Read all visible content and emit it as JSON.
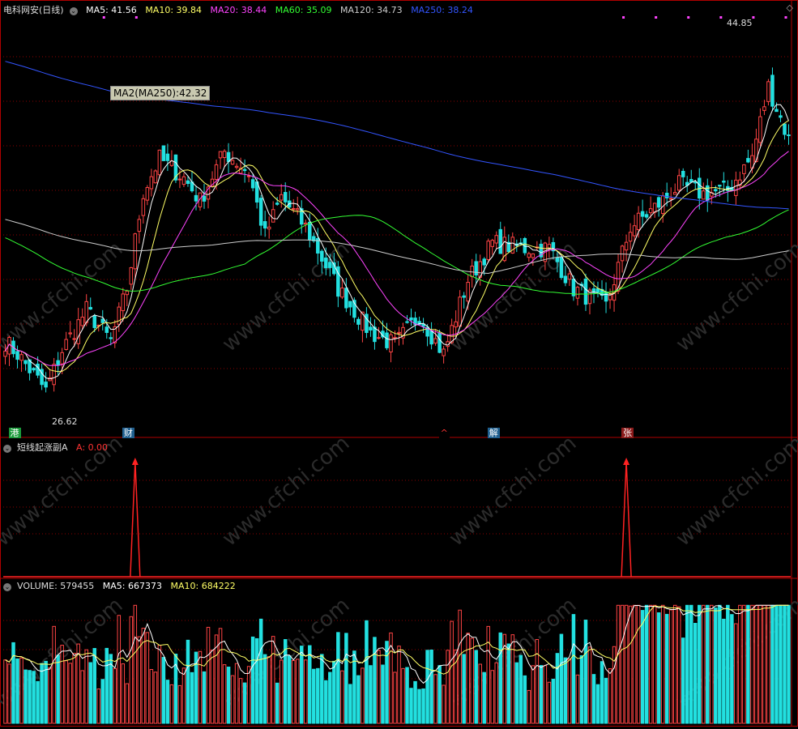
{
  "header": {
    "title": "电科网安(日线)",
    "ma": [
      {
        "label": "MA5: 41.56",
        "color": "#ffffff"
      },
      {
        "label": "MA10: 39.84",
        "color": "#ffff66"
      },
      {
        "label": "MA20: 38.44",
        "color": "#ff44ff"
      },
      {
        "label": "MA60: 35.09",
        "color": "#33ff33"
      },
      {
        "label": "MA120: 34.73",
        "color": "#cccccc"
      },
      {
        "label": "MA250: 38.24",
        "color": "#3355ff"
      }
    ]
  },
  "tooltip": "MA2(MA250):42.32",
  "price_labels": {
    "high": "44.85",
    "low": "26.62"
  },
  "event_tags": [
    {
      "text": "港",
      "color": "#1a9a3a",
      "fg": "#ffffff",
      "index": 2
    },
    {
      "text": "财",
      "color": "#1f5f8f",
      "fg": "#ffffff",
      "index": 30
    },
    {
      "text": "^",
      "color": "#000000",
      "fg": "#ff3333",
      "index": 108
    },
    {
      "text": "解",
      "color": "#1f5f8f",
      "fg": "#ffffff",
      "index": 120
    },
    {
      "text": "张",
      "color": "#8b1a1a",
      "fg": "#ffffff",
      "index": 153
    }
  ],
  "indicator": {
    "name": "短线起涨副A",
    "value_label": "A: 0.00",
    "signal_indices": [
      32,
      153
    ]
  },
  "volume": {
    "label": "VOLUME: 579455",
    "ma5_label": "MA5: 667373",
    "ma10_label": "MA10: 684222"
  },
  "colors": {
    "up": "#ff4444",
    "down": "#22e0e0",
    "grid": "#8b0000"
  },
  "watermark": "www.cfchi.com",
  "chart_data": {
    "type": "candlestick",
    "xlabel": "",
    "ylabel": "",
    "ylim": [
      25.0,
      48.5
    ],
    "anchors": [
      [
        0,
        30.0
      ],
      [
        3,
        29.3
      ],
      [
        10,
        27.2
      ],
      [
        14,
        29.5
      ],
      [
        20,
        31.8
      ],
      [
        26,
        30.0
      ],
      [
        30,
        33.0
      ],
      [
        34,
        38.5
      ],
      [
        38,
        40.4
      ],
      [
        44,
        39.3
      ],
      [
        48,
        38.0
      ],
      [
        54,
        40.8
      ],
      [
        60,
        39.6
      ],
      [
        64,
        36.0
      ],
      [
        68,
        38.2
      ],
      [
        74,
        36.5
      ],
      [
        82,
        33.0
      ],
      [
        90,
        30.5
      ],
      [
        96,
        29.8
      ],
      [
        102,
        31.5
      ],
      [
        108,
        29.3
      ],
      [
        114,
        33.5
      ],
      [
        120,
        35.6
      ],
      [
        128,
        35.3
      ],
      [
        134,
        35.3
      ],
      [
        140,
        33.0
      ],
      [
        148,
        32.0
      ],
      [
        154,
        36.5
      ],
      [
        160,
        37.6
      ],
      [
        166,
        38.9
      ],
      [
        172,
        38.4
      ],
      [
        178,
        38.6
      ],
      [
        184,
        40.5
      ],
      [
        188,
        44.5
      ],
      [
        193,
        41.5
      ]
    ],
    "n_candles": 194,
    "ma_periods": [
      5,
      10,
      20,
      60,
      120,
      250
    ]
  }
}
